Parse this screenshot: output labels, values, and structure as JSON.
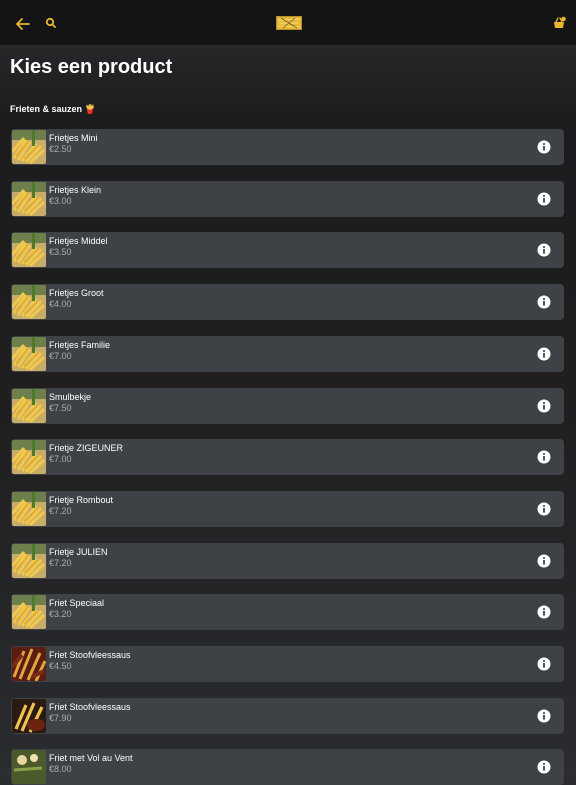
{
  "header": {
    "back_icon": "arrow-left-icon",
    "search_icon": "search-icon",
    "logo_icon": "brand-logo",
    "cart_icon": "basket-icon",
    "accent_color": "#e8b631"
  },
  "page": {
    "title": "Kies een product"
  },
  "section": {
    "title": "Frieten & sauzen",
    "emoji": "🍟"
  },
  "items": [
    {
      "name": "Frietjes Mini",
      "price": "€2.50",
      "thumb": "fries"
    },
    {
      "name": "Frietjes Klein",
      "price": "€3.00",
      "thumb": "fries"
    },
    {
      "name": "Frietjes Middel",
      "price": "€3.50",
      "thumb": "fries"
    },
    {
      "name": "Frietjes Groot",
      "price": "€4.00",
      "thumb": "fries"
    },
    {
      "name": "Frietjes Familie",
      "price": "€7.00",
      "thumb": "fries"
    },
    {
      "name": "Smulbekje",
      "price": "€7.50",
      "thumb": "fries"
    },
    {
      "name": "Frietje ZIGEUNER",
      "price": "€7.00",
      "thumb": "fries"
    },
    {
      "name": "Frietje Rombout",
      "price": "€7.20",
      "thumb": "fries"
    },
    {
      "name": "Frietje JULIEN",
      "price": "€7.20",
      "thumb": "fries"
    },
    {
      "name": "Friet Speciaal",
      "price": "€3.20",
      "thumb": "fries"
    },
    {
      "name": "Friet Stoofvleessaus",
      "price": "€4.50",
      "thumb": "stew"
    },
    {
      "name": "Friet Stoofvleessaus",
      "price": "€7.90",
      "thumb": "stew-fries"
    },
    {
      "name": "Friet met Vol au Vent",
      "price": "€8.00",
      "thumb": "vol-au-vent"
    }
  ]
}
